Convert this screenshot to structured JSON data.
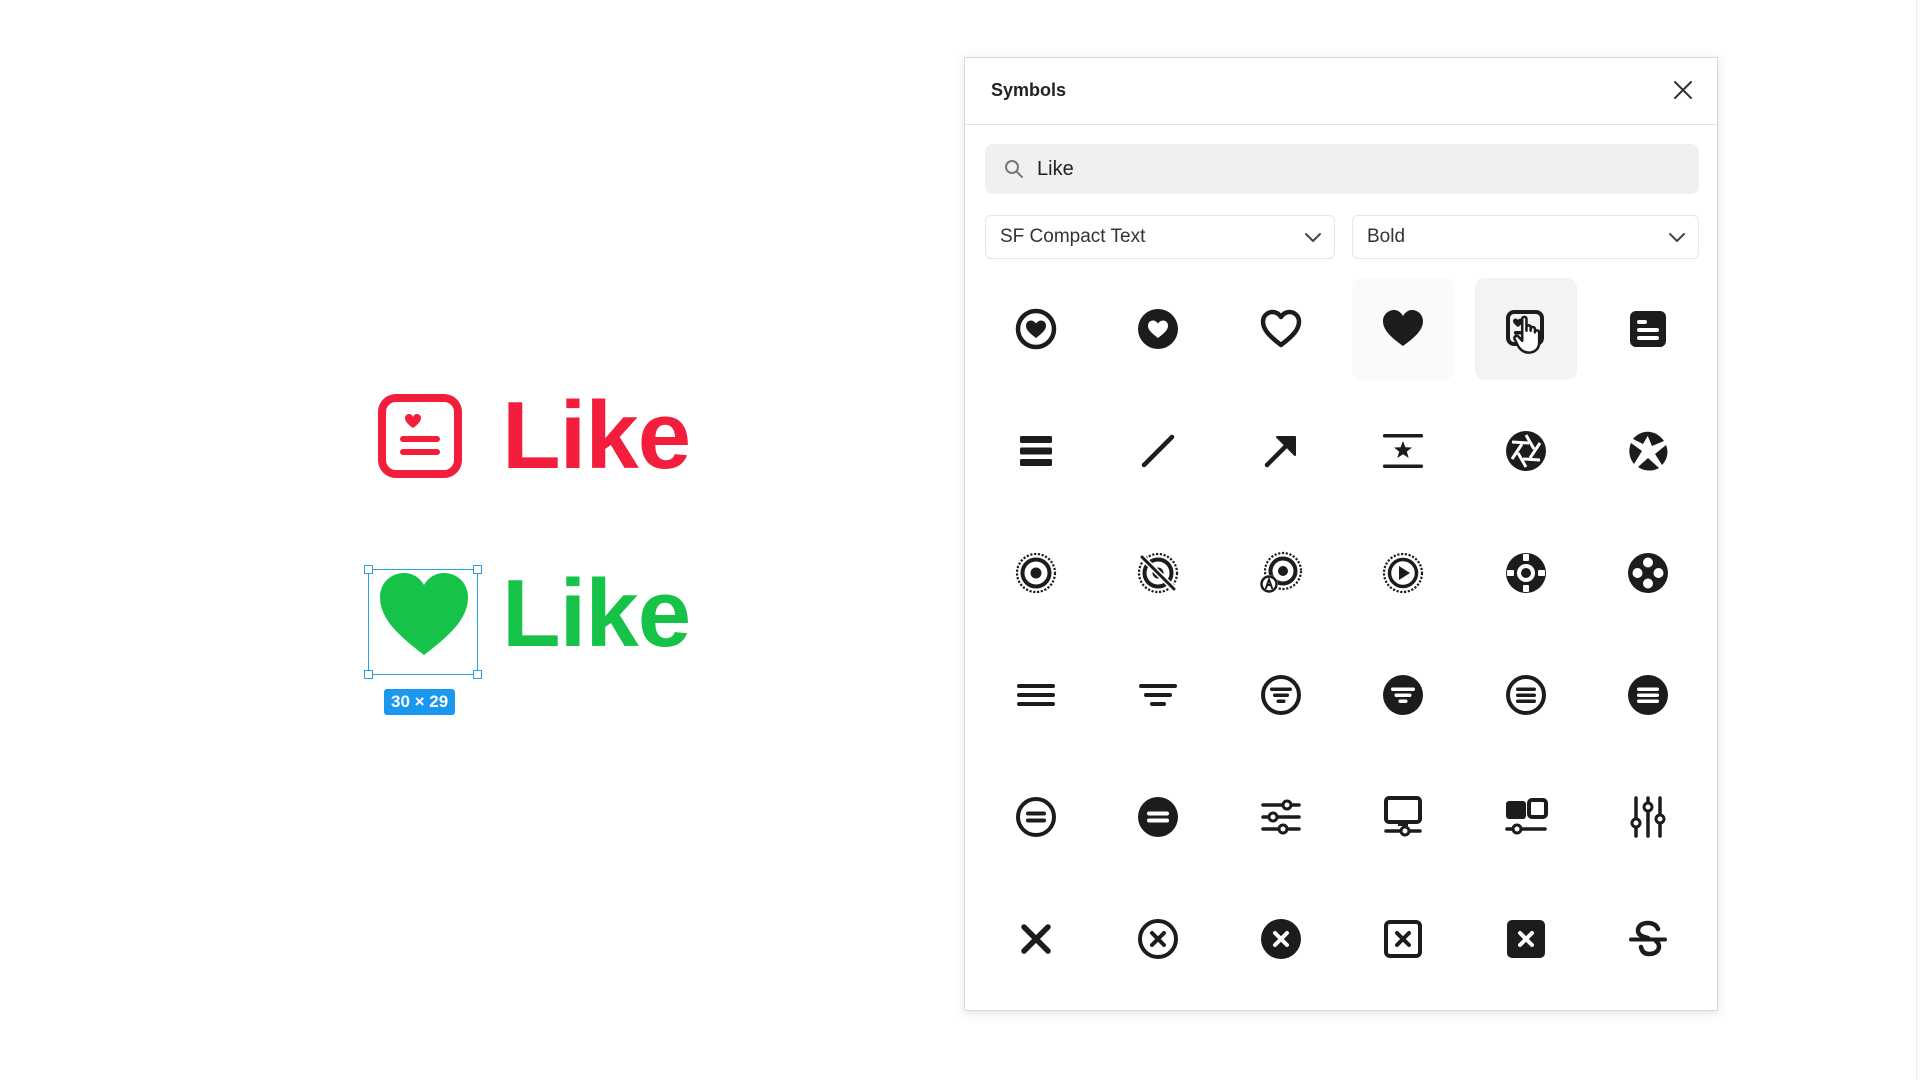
{
  "canvas": {
    "like_red": {
      "label": "Like",
      "color": "#f31e3c",
      "icon": "text-bubble-heart-icon"
    },
    "like_green": {
      "label": "Like",
      "color": "#16c247",
      "icon": "heart-fill-icon"
    },
    "selection_size": "30 × 29",
    "selection_color": "#2b9bf0"
  },
  "panel": {
    "title": "Symbols",
    "search": {
      "value": "Like",
      "placeholder": "Search"
    },
    "font_select": {
      "value": "SF Compact Text"
    },
    "weight_select": {
      "value": "Bold"
    },
    "symbols": [
      "heart-circle-icon",
      "heart-circle-fill-icon",
      "heart-icon",
      "heart-fill-icon",
      "heart-text-square-icon",
      "text-square-fill-icon",
      "line-3-horizontal-fill-icon",
      "line-diagonal-icon",
      "arrow-up-right-icon",
      "text-below-star-icon",
      "camera-aperture-fill-icon",
      "camera-aperture-icon",
      "dot-radiowaves-circle-icon",
      "dot-radiowaves-slash-icon",
      "dot-radiowaves-a-icon",
      "play-radiowaves-circle-icon",
      "life-preserver-icon",
      "circle-dots-fill-icon",
      "line-3-horizontal-icon",
      "line-3-decrease-icon",
      "line-3-decrease-circle-icon",
      "line-3-decrease-circle-fill-icon",
      "line-3-circle-icon",
      "line-3-circle-fill-icon",
      "equal-circle-icon",
      "equal-circle-fill-icon",
      "slider-horizontal-3-icon",
      "display-slider-icon",
      "display-2-slider-icon",
      "slider-vertical-3-icon",
      "xmark-icon",
      "xmark-circle-icon",
      "xmark-circle-fill-icon",
      "xmark-square-icon",
      "xmark-square-fill-icon",
      "strikethrough-icon"
    ]
  }
}
